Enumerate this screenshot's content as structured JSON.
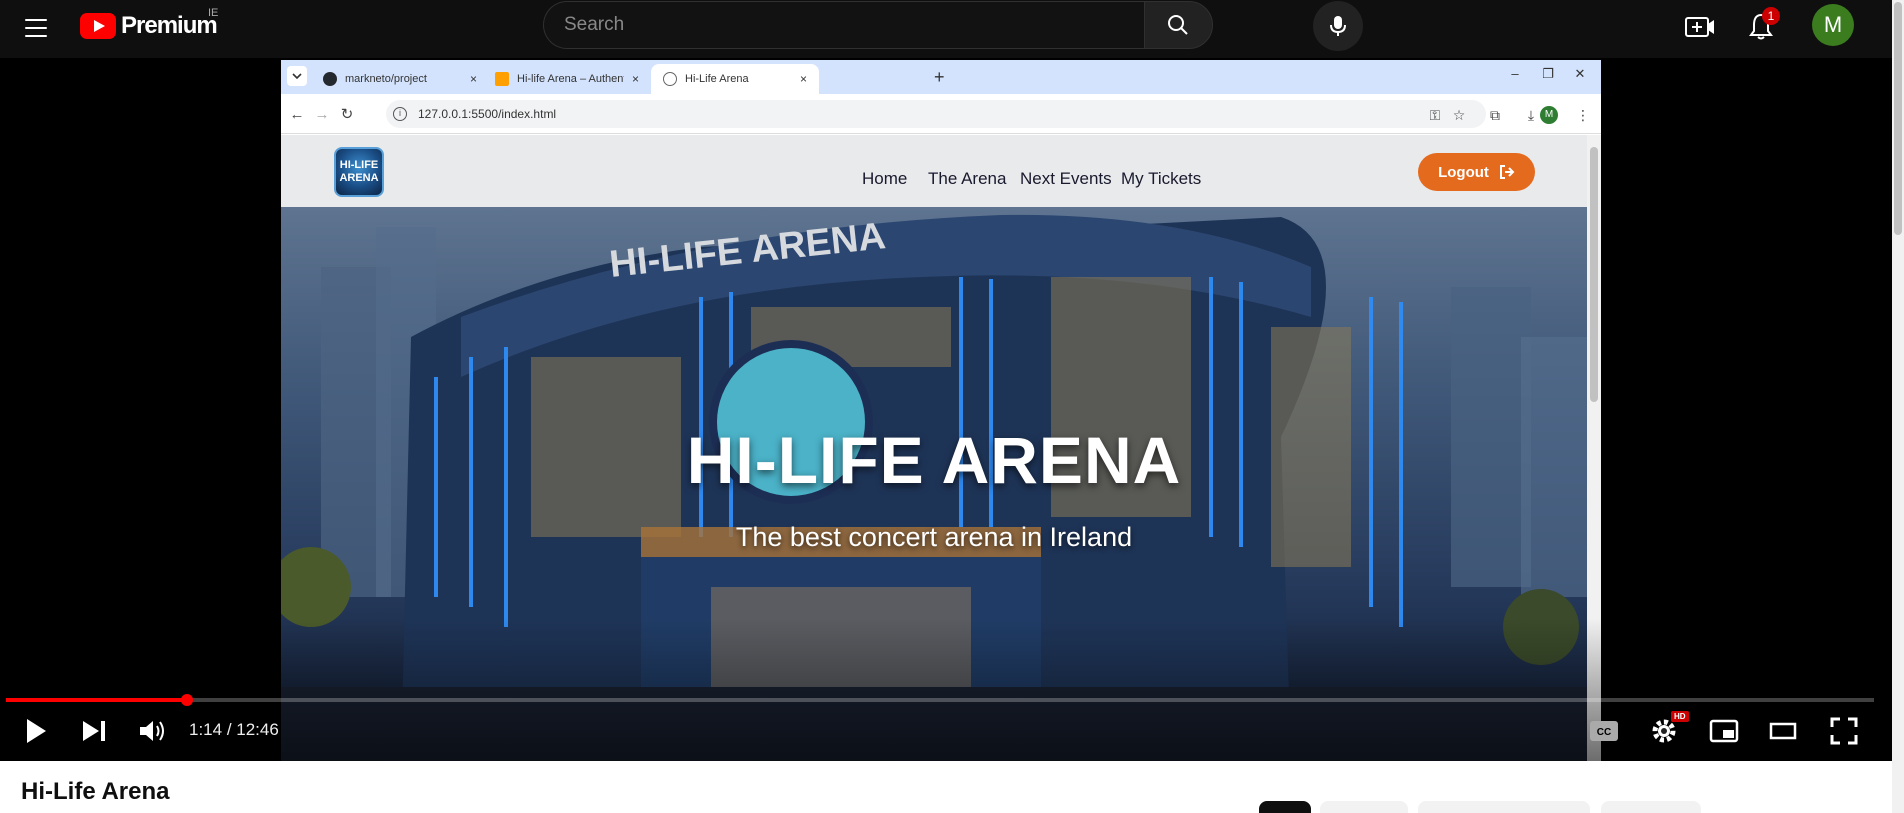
{
  "youtube": {
    "logo_text": "Premium",
    "country_code": "IE",
    "search_placeholder": "Search",
    "notification_count": "1",
    "avatar_letter": "M"
  },
  "browser": {
    "tabs": [
      {
        "title": "markneto/project",
        "close": "×",
        "icon": "github-icon"
      },
      {
        "title": "Hi-life Arena – Authentication -",
        "close": "×",
        "icon": "firebase-icon"
      },
      {
        "title": "Hi-Life Arena",
        "close": "×",
        "icon": "globe-icon"
      }
    ],
    "new_tab": "+",
    "window_controls": {
      "minimize": "–",
      "restore": "❐",
      "close": "✕"
    },
    "url": "127.0.0.1:5500/index.html",
    "profile_letter": "M"
  },
  "site": {
    "logo_text": "HI-LIFE ARENA",
    "nav": [
      "Home",
      "The Arena",
      "Next Events",
      "My Tickets"
    ],
    "logout_label": "Logout",
    "hero_title": "HI-LIFE ARENA",
    "hero_subtitle": "The best concert arena in Ireland",
    "building_sign": "HI-LIFE ARENA"
  },
  "player": {
    "time_current": "1:14",
    "time_separator": " / ",
    "time_total": "12:46",
    "progress_fraction": 0.097,
    "hd_label": "HD",
    "accent_color": "#ff0000"
  },
  "video": {
    "title": "Hi-Life Arena"
  }
}
